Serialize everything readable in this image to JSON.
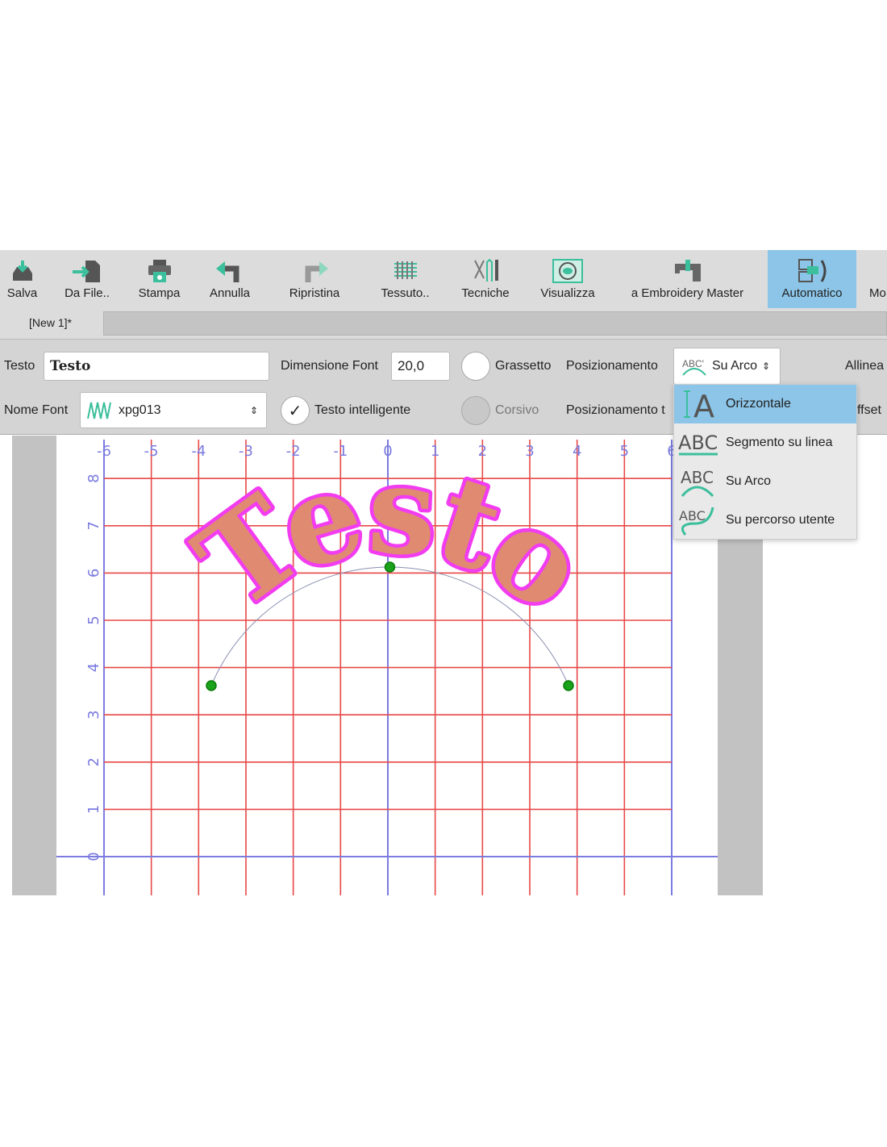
{
  "toolbar": {
    "items": [
      {
        "label": "Salva",
        "icon": "save-tray-icon"
      },
      {
        "label": "Da File..",
        "icon": "import-file-icon"
      },
      {
        "label": "Stampa",
        "icon": "printer-icon"
      },
      {
        "label": "Annulla",
        "icon": "undo-icon"
      },
      {
        "label": "Ripristina",
        "icon": "redo-icon"
      },
      {
        "label": "Tessuto..",
        "icon": "fabric-icon"
      },
      {
        "label": "Tecniche",
        "icon": "tools-icon"
      },
      {
        "label": "Visualizza",
        "icon": "eye-icon"
      },
      {
        "label": "a Embroidery Master",
        "icon": "sewing-machine-icon"
      },
      {
        "label": "Automatico",
        "icon": "automatic-icon",
        "active": true
      },
      {
        "label": "Mo"
      }
    ]
  },
  "tabs": [
    {
      "label": "[New 1]*"
    }
  ],
  "props": {
    "testo_label": "Testo",
    "testo_value": "Testo",
    "dim_label": "Dimensione Font",
    "dim_value": "20,0",
    "grassetto": "Grassetto",
    "pos_label": "Posizionamento",
    "pos_value": "Su Arco",
    "allinea": "Allinea",
    "nome_font_label": "Nome Font",
    "nome_font_value": "xpg013",
    "testo_intelligente": "Testo intelligente",
    "testo_intelligente_checked": true,
    "corsivo": "Corsivo",
    "grassetto_checked": false,
    "corsivo_checked": false,
    "pos2_label": "Posizionamento t",
    "offset": "ffset"
  },
  "dropdown": {
    "items": [
      {
        "label": "Orizzontale",
        "icon": "horizontal-text-icon",
        "selected": true
      },
      {
        "label": "Segmento su linea",
        "icon": "text-on-line-icon"
      },
      {
        "label": "Su Arco",
        "icon": "text-on-arc-icon"
      },
      {
        "label": "Su percorso utente",
        "icon": "text-on-path-icon"
      }
    ]
  },
  "canvas": {
    "x_ticks": [
      "-6",
      "-5",
      "-4",
      "-3",
      "-2",
      "-1",
      "0",
      "1",
      "2",
      "3",
      "4",
      "5",
      "6"
    ],
    "y_ticks": [
      "0",
      "1",
      "2",
      "3",
      "4",
      "5",
      "6",
      "7",
      "8"
    ],
    "design_text": "Testo",
    "colors": {
      "grid": "#e84848",
      "axis": "#7b7be0",
      "fill": "#e08a72",
      "outline": "#f23cf0",
      "handle": "#1aa31a"
    }
  }
}
